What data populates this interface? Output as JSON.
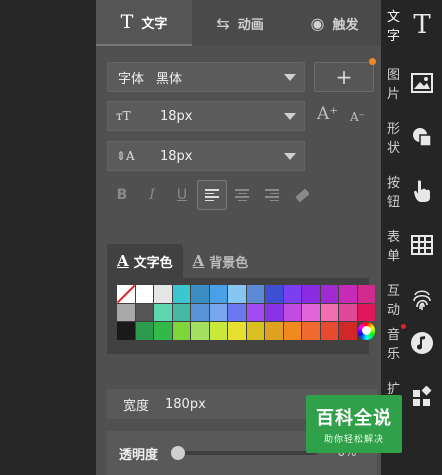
{
  "tabs": [
    {
      "label": "文字",
      "icon": "text-T-icon"
    },
    {
      "label": "动画",
      "icon": "swap-arrows-icon"
    },
    {
      "label": "触发",
      "icon": "target-circle-icon"
    }
  ],
  "font": {
    "label": "字体",
    "value": "黑体"
  },
  "font_size": {
    "value": "18px"
  },
  "line_height": {
    "value": "18px"
  },
  "add_button": {
    "label": "+"
  },
  "size_adjust": {
    "increase": "A⁺",
    "decrease": "A⁻"
  },
  "format": {
    "bold": "B",
    "italic": "I",
    "underline": "U"
  },
  "color_tabs": [
    {
      "label": "文字色",
      "icon": "A"
    },
    {
      "label": "背景色",
      "icon": "A"
    }
  ],
  "palette": [
    "none",
    "#ffffff",
    "#e6e6e6",
    "#3cc6d0",
    "#3b8ec2",
    "#4aa0e6",
    "#86c6f2",
    "#5b8ad6",
    "#3f4fd4",
    "#7a3ff0",
    "#8a2be2",
    "#a02bd0",
    "#c82ab8",
    "#d02a8a",
    "#a8a8a8",
    "#555555",
    "#5ed6b0",
    "#44b8a0",
    "#5a94d8",
    "#7aa6f0",
    "#6a78f0",
    "#a04cf0",
    "#8a32e6",
    "#c04ce0",
    "#e066d8",
    "#f070b0",
    "#e04898",
    "#e0185a",
    "#1a1a1a",
    "#2e9a4e",
    "#33b84a",
    "#7fd63a",
    "#a6e060",
    "#c8e83a",
    "#e8e030",
    "#d8c020",
    "#e0a020",
    "#f08a20",
    "#f06a30",
    "#e84a30",
    "#d02828",
    "wheel"
  ],
  "width": {
    "label": "宽度",
    "value": "180px"
  },
  "opacity": {
    "label": "透明度",
    "value": "0%",
    "level": 0
  },
  "rail": [
    {
      "label": "文字",
      "icon": "text-T-icon"
    },
    {
      "label": "图片",
      "icon": "image-icon"
    },
    {
      "label": "形状",
      "icon": "shapes-icon"
    },
    {
      "label": "按钮",
      "icon": "pointer-hand-icon"
    },
    {
      "label": "表单",
      "icon": "table-icon"
    },
    {
      "label": "互动",
      "icon": "fingerprint-icon"
    },
    {
      "label": "音乐",
      "icon": "music-icon"
    },
    {
      "label": "扩",
      "icon": "extend-blocks-icon"
    }
  ],
  "watermark": {
    "title": "百科全说",
    "subtitle": "助你轻松解决"
  },
  "colors": {
    "panel": "#505050",
    "rail": "#252525",
    "accent_dot": "#f08a24",
    "watermark_green": "#30a04a"
  }
}
